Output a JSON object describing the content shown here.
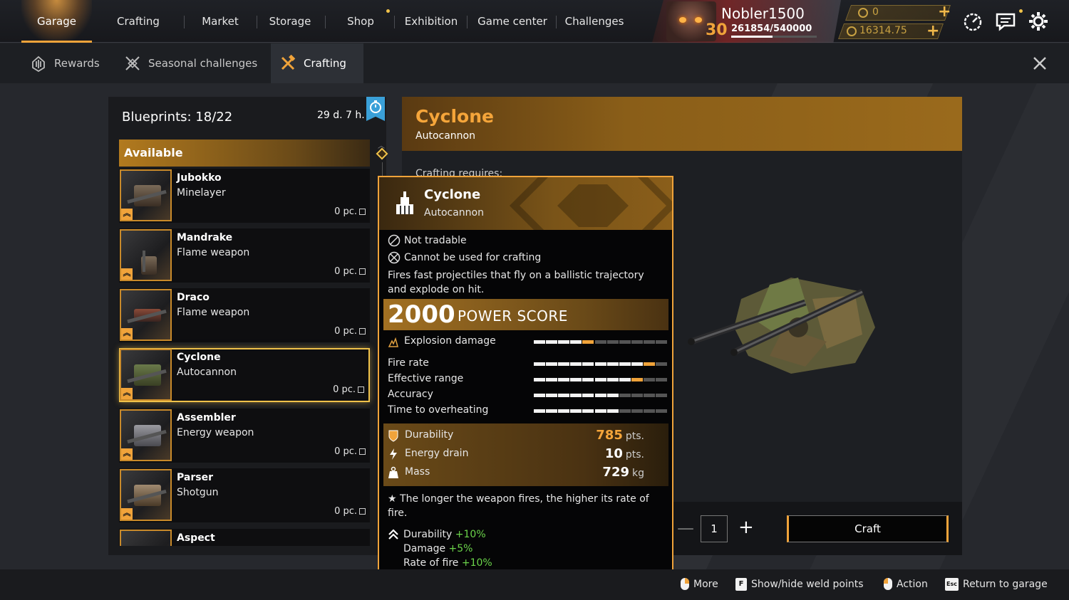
{
  "nav": {
    "items": [
      {
        "label": "Garage"
      },
      {
        "label": "Crafting"
      },
      {
        "label": "Market"
      },
      {
        "label": "Storage"
      },
      {
        "label": "Shop"
      },
      {
        "label": "Exhibition"
      },
      {
        "label": "Game center"
      },
      {
        "label": "Challenges"
      }
    ]
  },
  "profile": {
    "username": "Nobler1500",
    "level": "30",
    "xp": "261854/540000",
    "xp_progress": 0.485,
    "currency1": "0",
    "currency2": "16314.75"
  },
  "subtabs": {
    "rewards": "Rewards",
    "seasonal": "Seasonal challenges",
    "crafting": "Crafting"
  },
  "blueprints": {
    "count_label": "Blueprints: 18/22",
    "time_left": "29 d. 7 h.",
    "section": "Available",
    "items": [
      {
        "name": "Jubokko",
        "type": "Minelayer",
        "qty": "0 pc."
      },
      {
        "name": "Mandrake",
        "type": "Flame weapon",
        "qty": "0 pc."
      },
      {
        "name": "Draco",
        "type": "Flame weapon",
        "qty": "0 pc."
      },
      {
        "name": "Cyclone",
        "type": "Autocannon",
        "qty": "0 pc."
      },
      {
        "name": "Assembler",
        "type": "Energy weapon",
        "qty": "0 pc."
      },
      {
        "name": "Parser",
        "type": "Shotgun",
        "qty": "0 pc."
      },
      {
        "name": "Aspect",
        "type": "",
        "qty": ""
      }
    ]
  },
  "detail": {
    "title": "Cyclone",
    "subtitle": "Autocannon",
    "requires": "Crafting requires:",
    "quantity": "1",
    "craft_label": "Craft"
  },
  "tooltip": {
    "name": "Cyclone",
    "type": "Autocannon",
    "not_tradable": "Not tradable",
    "no_crafting": "Cannot be used for crafting",
    "description": "Fires fast projectiles that fly on a ballistic trajectory and explode on hit.",
    "power_score": "2000",
    "power_label": "POWER SCORE",
    "stats": [
      {
        "label": "Explosion damage",
        "value": 4.5,
        "max": 11
      },
      {
        "label": "Fire rate",
        "value": 9.5,
        "max": 11
      },
      {
        "label": "Effective range",
        "value": 8.5,
        "max": 11
      },
      {
        "label": "Accuracy",
        "value": 7,
        "max": 11
      },
      {
        "label": "Time to overheating",
        "value": 7,
        "max": 11
      }
    ],
    "attributes": [
      {
        "label": "Durability",
        "value": "785",
        "unit": "pts.",
        "color": "#f5a53a"
      },
      {
        "label": "Energy drain",
        "value": "10",
        "unit": "pts.",
        "color": "#ffffff"
      },
      {
        "label": "Mass",
        "value": "729",
        "unit": "kg",
        "color": "#ffffff"
      }
    ],
    "note": "The longer the weapon fires, the higher its rate of fire.",
    "bonuses": [
      {
        "label": "Durability",
        "value": "+10%"
      },
      {
        "label": "Damage",
        "value": "+5%"
      },
      {
        "label": "Rate of fire",
        "value": "+10%"
      }
    ]
  },
  "hints": {
    "more": "More",
    "weld_key": "F",
    "weld": "Show/hide weld points",
    "action": "Action",
    "esc_key": "Esc",
    "return": "Return to garage"
  },
  "colors": {
    "accent": "#f0a33a",
    "green": "#6bd44a",
    "timer_badge": "#3aa0d8"
  }
}
